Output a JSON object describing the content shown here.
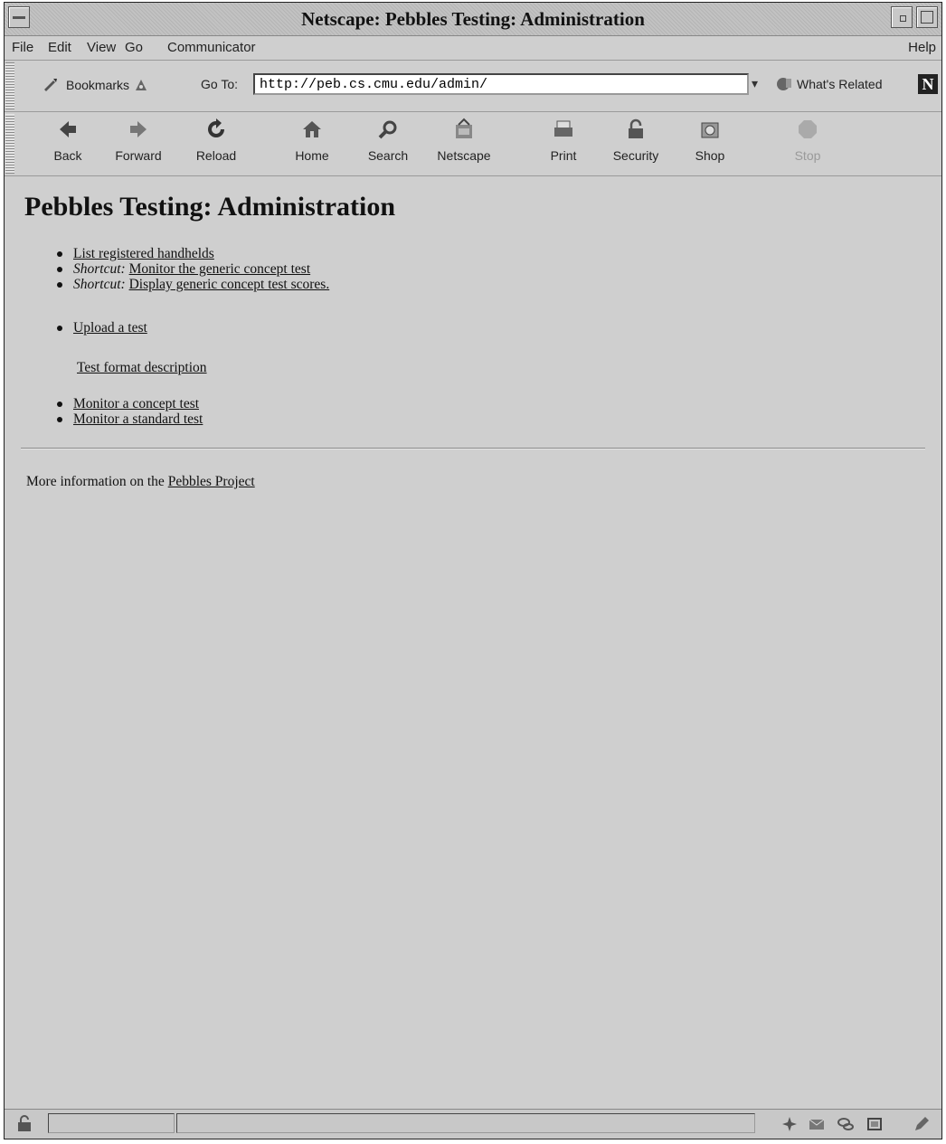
{
  "window": {
    "title": "Netscape: Pebbles Testing: Administration"
  },
  "menu": {
    "items": [
      "File",
      "Edit",
      "View",
      "Go",
      "Communicator"
    ],
    "help": "Help"
  },
  "location": {
    "bookmarks_label": "Bookmarks",
    "goto_label": "Go To:",
    "url": "http://peb.cs.cmu.edu/admin/",
    "whats_related": "What's Related"
  },
  "toolbar": {
    "buttons": [
      {
        "label": "Back",
        "icon": "back-arrow-icon"
      },
      {
        "label": "Forward",
        "icon": "forward-arrow-icon"
      },
      {
        "label": "Reload",
        "icon": "reload-icon"
      },
      {
        "label": "Home",
        "icon": "home-icon"
      },
      {
        "label": "Search",
        "icon": "search-icon"
      },
      {
        "label": "Netscape",
        "icon": "netscape-icon"
      },
      {
        "label": "Print",
        "icon": "print-icon"
      },
      {
        "label": "Security",
        "icon": "lock-icon"
      },
      {
        "label": "Shop",
        "icon": "shop-icon"
      },
      {
        "label": "Stop",
        "icon": "stop-icon",
        "disabled": true
      }
    ]
  },
  "page": {
    "title": "Pebbles Testing: Administration",
    "list1": {
      "item1": "List registered handhelds",
      "item2_prefix": "Shortcut:",
      "item2_link": "Monitor the generic concept test",
      "item3_prefix": "Shortcut:",
      "item3_link": "Display generic concept test scores."
    },
    "upload_link": "Upload a test",
    "format_link": "Test format description",
    "list3": {
      "item1": "Monitor a concept test",
      "item2": "Monitor a standard test"
    },
    "footer_text": "More information on the",
    "footer_link": "Pebbles Project"
  }
}
